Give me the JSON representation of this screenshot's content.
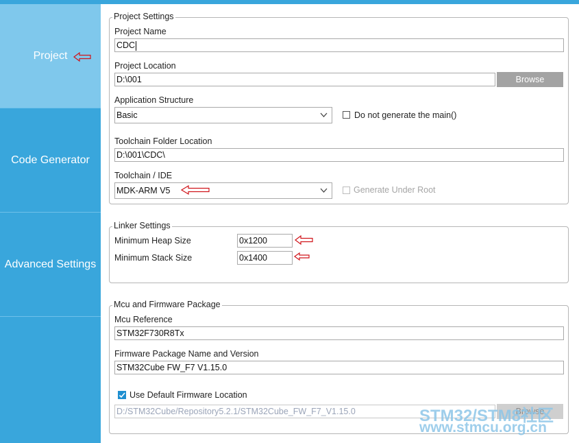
{
  "sidebar": {
    "tabs": [
      {
        "label": "Project",
        "active": true
      },
      {
        "label": "Code Generator",
        "active": false
      },
      {
        "label": "Advanced Settings",
        "active": false
      }
    ]
  },
  "project_settings": {
    "title": "Project Settings",
    "project_name_label": "Project Name",
    "project_name_value": "CDC",
    "project_location_label": "Project Location",
    "project_location_value": "D:\\001",
    "browse_label": "Browse",
    "app_structure_label": "Application Structure",
    "app_structure_value": "Basic",
    "no_main_label": "Do not generate the main()",
    "toolchain_folder_label": "Toolchain Folder Location",
    "toolchain_folder_value": "D:\\001\\CDC\\",
    "toolchain_ide_label": "Toolchain / IDE",
    "toolchain_ide_value": "MDK-ARM V5",
    "generate_under_root_label": "Generate Under Root"
  },
  "linker_settings": {
    "title": "Linker Settings",
    "heap_label": "Minimum Heap Size",
    "heap_value": "0x1200",
    "stack_label": "Minimum Stack Size",
    "stack_value": "0x1400"
  },
  "mcu_firmware": {
    "title": "Mcu and Firmware Package",
    "mcu_ref_label": "Mcu Reference",
    "mcu_ref_value": "STM32F730R8Tx",
    "fw_name_label": "Firmware Package Name and Version",
    "fw_name_value": "STM32Cube FW_F7 V1.15.0",
    "use_default_label": "Use Default Firmware Location",
    "use_default_checked": true,
    "fw_path_value": "D:/STM32Cube/Repository5.2.1/STM32Cube_FW_F7_V1.15.0",
    "browse_label": "Browse"
  },
  "watermark": {
    "line1": "STM32/STM8社区",
    "line2": "www.stmcu.org.cn"
  },
  "colors": {
    "sidebar": "#39a6dc",
    "sidebar_active": "#7fc8ec",
    "annotation_arrow": "#d0141a",
    "button": "#a3a3a3"
  }
}
